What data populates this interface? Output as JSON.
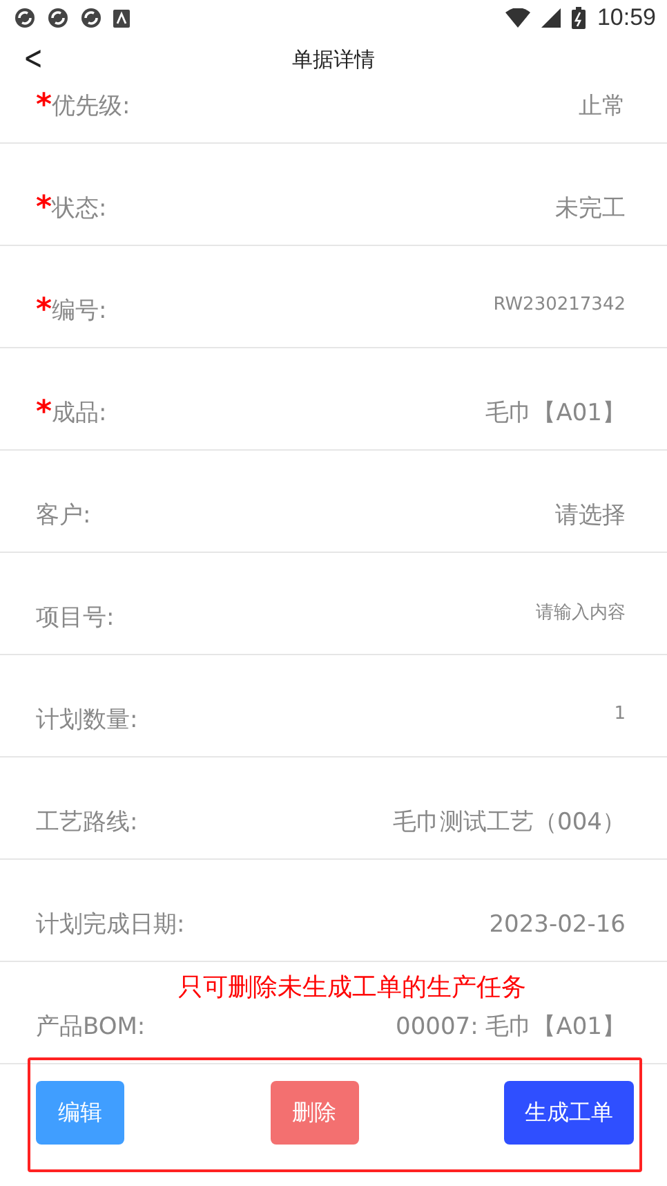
{
  "status_bar": {
    "time": "10:59"
  },
  "header": {
    "back": "<",
    "title": "单据详情"
  },
  "fields": [
    {
      "label": "优先级:",
      "marker": "*",
      "value": "止常",
      "small": false
    },
    {
      "label": "状态:",
      "marker": "*",
      "value": "未完工",
      "small": false
    },
    {
      "label": "编号:",
      "marker": "*",
      "value": "RW230217342",
      "small": true
    },
    {
      "label": "成品:",
      "marker": "*",
      "value": "毛巾【A01】",
      "small": false
    },
    {
      "label": "客户:",
      "value": "请选择",
      "small": false
    },
    {
      "label": "项目号:",
      "value": "请输入内容",
      "small": true
    },
    {
      "label": "计划数量:",
      "value": "1",
      "small": true
    },
    {
      "label": "工艺路线:",
      "value": "毛巾测试工艺（004）",
      "small": false
    },
    {
      "label": "计划完成日期:",
      "value": "2023-02-16",
      "small": false
    },
    {
      "label": "产品BOM:",
      "value": "00007: 毛巾【A01】",
      "small": false
    }
  ],
  "buttons": [
    {
      "label": "编辑",
      "color": "#409eff"
    },
    {
      "label": "删除",
      "color": "#f37070"
    },
    {
      "label": "生成工单",
      "color": "#2f4fff"
    }
  ],
  "annotation": {
    "text": "只可删除未生成工单的生产任务"
  }
}
